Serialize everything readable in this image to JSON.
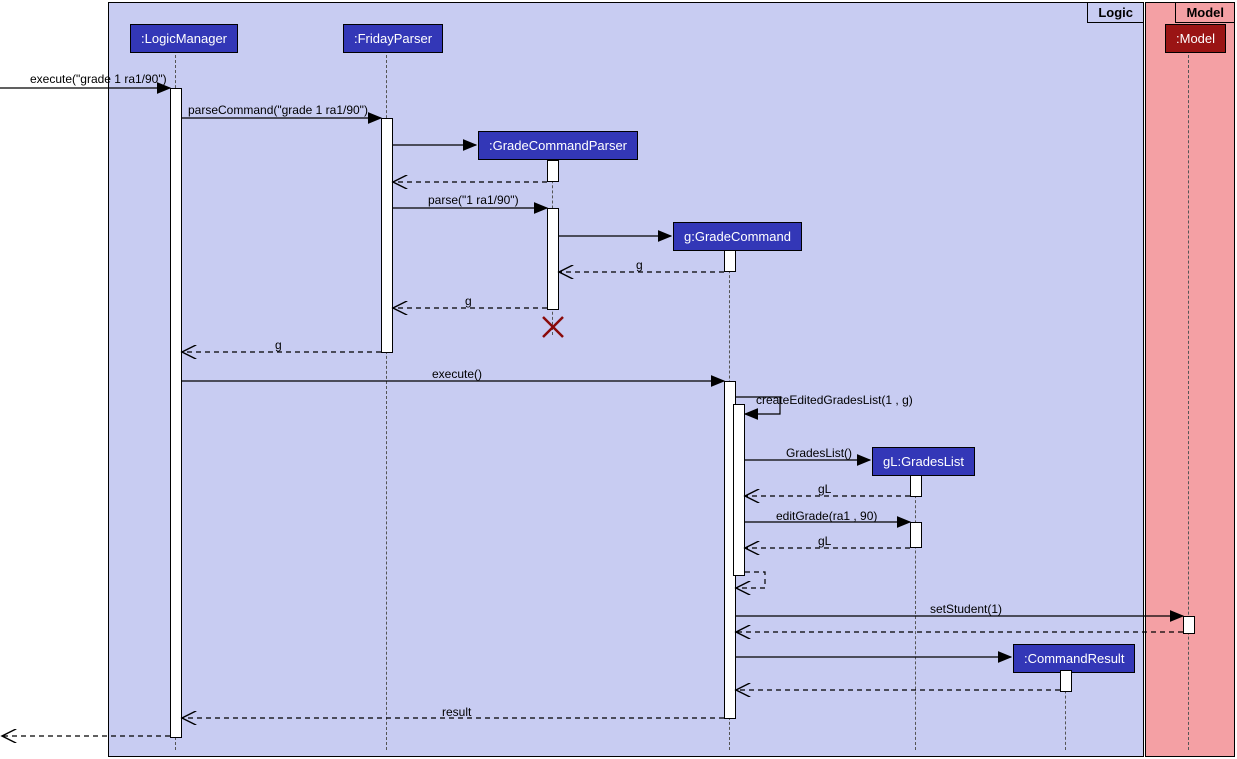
{
  "frames": {
    "logic": "Logic",
    "model": "Model"
  },
  "participants": {
    "logicManager": ":LogicManager",
    "fridayParser": ":FridayParser",
    "gradeCommandParser": ":GradeCommandParser",
    "gradeCommand": "g:GradeCommand",
    "gradesList": "gL:GradesList",
    "commandResult": ":CommandResult",
    "modelObj": ":Model"
  },
  "messages": {
    "m1": "execute(\"grade 1 ra1/90\")",
    "m2": "parseCommand(\"grade 1 ra1/90\")",
    "m3": "parse(\"1 ra1/90\")",
    "m4": "g",
    "m5": "g",
    "m6": "g",
    "m7": "execute()",
    "m8": "createEditedGradesList(1 , g)",
    "m9": "GradesList()",
    "m10": "gL",
    "m11": "editGrade(ra1 , 90)",
    "m12": "gL",
    "m13": "setStudent(1)",
    "m14": "result"
  },
  "colors": {
    "logicBg": "#c8ccf2",
    "modelBg": "#f4a0a4",
    "boxBg": "#3337b7",
    "modelBoxBg": "#9a1414"
  }
}
